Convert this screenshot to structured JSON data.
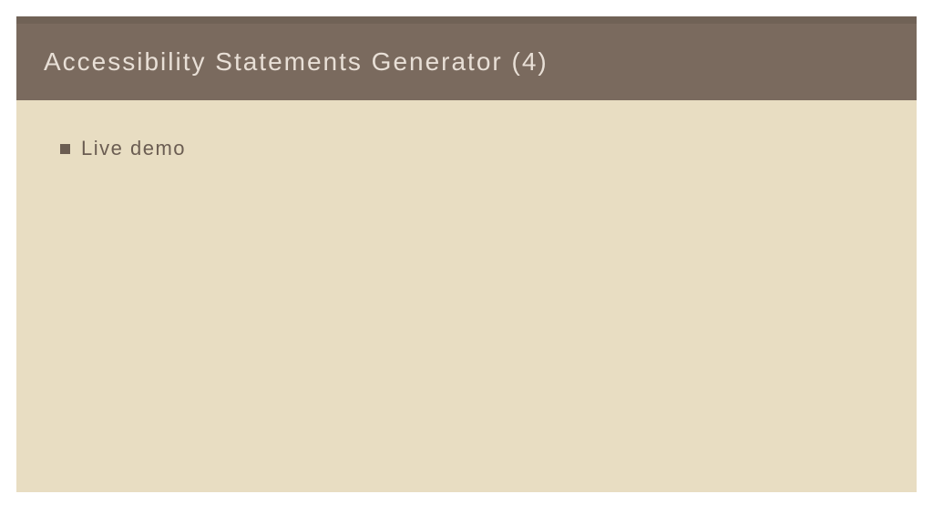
{
  "slide": {
    "title": "Accessibility Statements Generator (4)",
    "bullets": [
      {
        "text": "Live demo"
      }
    ]
  },
  "colors": {
    "header_bg": "#7a6a5e",
    "header_border": "#706256",
    "header_text": "#e8dfd6",
    "content_bg": "#e8ddc2",
    "bullet_color": "#6b5d52",
    "text_color": "#6b5d52"
  }
}
